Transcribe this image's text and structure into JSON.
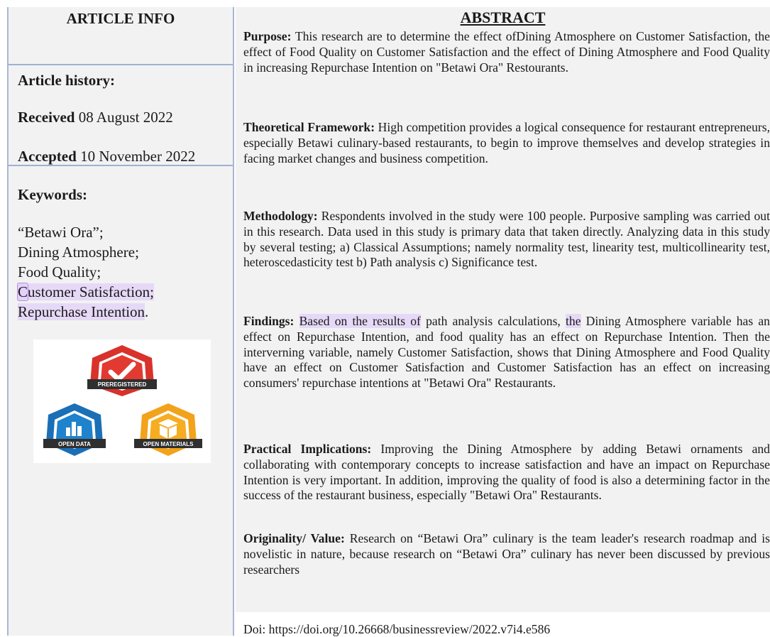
{
  "article_info": {
    "title": "ARTICLE INFO",
    "history_title": "Article history:",
    "received_label": "Received",
    "received_date": "08 August 2022",
    "accepted_label": "Accepted",
    "accepted_date": "10 November 2022",
    "keywords_title": "Keywords:",
    "keywords": [
      "“Betawi Ora”;",
      "Dining Atmosphere;",
      "Food Quality;",
      "Customer Satisfaction;",
      "Repurchase Intention."
    ]
  },
  "badges": {
    "preregistered": "PREREGISTERED",
    "open_data": "OPEN DATA",
    "open_materials": "OPEN MATERIALS"
  },
  "colors": {
    "accent_line": "#9fb0d6",
    "highlight": "#e6d9f7",
    "badge_red": "#d8322b",
    "badge_blue": "#1a6fb6",
    "badge_orange": "#f2a21b"
  },
  "abstract": {
    "title": "ABSTRACT",
    "purpose": {
      "label": "Purpose:",
      "text": " This research are to determine the effect ofDining Atmosphere on Customer Satisfaction, the effect of Food Quality on Customer Satisfaction and the effect of Dining Atmosphere and Food Quality in increasing Repurchase Intention on \"Betawi Ora\" Restourants."
    },
    "theoretical": {
      "label": "Theoretical Framework:",
      "text": " High competition provides a logical consequence for restaurant entrepreneurs, especially Betawi culinary-based restaurants, to begin to improve themselves and develop strategies in facing market changes and business competition."
    },
    "methodology": {
      "label": "Methodology:",
      "text": " Respondents involved in the study were 100 people. Purposive sampling was carried out in this research. Data used in this study is primary data that taken directly. Analyzing data in this study by several testing; a) Classical Assumptions; namely normality test, linearity test, multicollinearity test, heteroscedasticity test b) Path analysis c) Significance test."
    },
    "findings": {
      "label": "Findings:",
      "hl1": "Based on the results of",
      "mid": " path analysis calculations, ",
      "hl2": "the",
      "rest": " Dining Atmosphere variable has an effect on Repurchase Intention, and food quality has an effect on Repurchase Intention. Then the interverning variable, namely Customer Satisfaction, shows that Dining Atmosphere and Food Quality have an effect on Customer Satisfaction and Customer Satisfaction has an effect on increasing consumers' repurchase intentions at \"Betawi Ora\" Restaurants."
    },
    "practical": {
      "label": "Practical Implications:",
      "text": " Improving the Dining Atmosphere by adding Betawi ornaments and collaborating with contemporary concepts to increase satisfaction and have an impact on Repurchase Intention is very important. In addition, improving the quality of food is also a determining factor in the success of the restaurant business, especially \"Betawi Ora\" Restaurants."
    },
    "originality": {
      "label": "Originality/ Value:",
      "text": " Research on “Betawi Ora” culinary is the team leader's research roadmap and is novelistic in nature, because research on “Betawi Ora” culinary has never been discussed by previous researchers"
    },
    "doi": "Doi: https://doi.org/10.26668/businessreview/2022.v7i4.e586"
  }
}
